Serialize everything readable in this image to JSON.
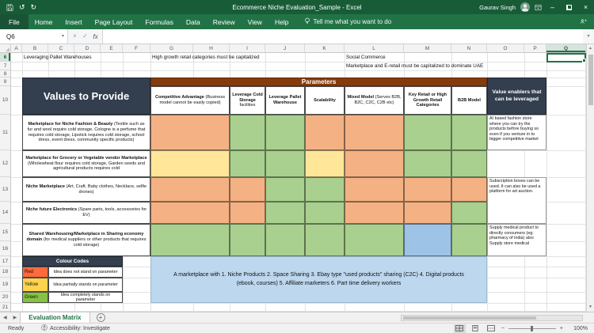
{
  "colors": {
    "title_bar": "#185C37",
    "ribbon": "#217346",
    "header_dark": "#333F4F",
    "parameters_bar": "#843C0C",
    "summary_note_bg": "#BDD7EE",
    "selection_accent": "#217346",
    "matrix_cells": {
      "orange": "#F4B183",
      "yellow": "#FFE699",
      "green": "#A9D08E",
      "blue": "#9DC3E6"
    }
  },
  "icons": {
    "undo": "↺",
    "redo": "↻",
    "dropdown": "▾",
    "cancel": "×",
    "check": "✓",
    "minimize": "–",
    "close": "×",
    "prev": "◀",
    "next": "▶",
    "up": "▲",
    "down": "▼",
    "plus": "+",
    "minus": "−"
  },
  "title_bar": {
    "title": "Ecommerce Niche Evaluation_Sample - Excel",
    "user_name": "Gaurav Singh"
  },
  "ribbon": {
    "tabs": [
      {
        "label": "File"
      },
      {
        "label": "Home"
      },
      {
        "label": "Insert"
      },
      {
        "label": "Page Layout"
      },
      {
        "label": "Formulas"
      },
      {
        "label": "Data"
      },
      {
        "label": "Review"
      },
      {
        "label": "View"
      },
      {
        "label": "Help"
      }
    ],
    "tell_me": "Tell me what you want to do"
  },
  "formula_bar": {
    "name_box": "Q6",
    "fx_label": "fx",
    "value": ""
  },
  "column_letters": [
    "A",
    "B",
    "C",
    "D",
    "E",
    "F",
    "G",
    "H",
    "I",
    "J",
    "K",
    "L",
    "M",
    "N",
    "O",
    "P",
    "Q"
  ],
  "row_numbers": [
    "6",
    "7",
    "8",
    "9",
    "10",
    "11",
    "12",
    "13",
    "14",
    "15",
    "16",
    "17",
    "18",
    "19",
    "20",
    "21"
  ],
  "notes": {
    "b6": "Leveraging Pallet Warehouses",
    "g6": "High growth retail categories must be capitalized",
    "l6": "Social Commerce",
    "l7": "Marketplace and E-retail must be capitalized to dominate UAE"
  },
  "matrix": {
    "values_header": "Values to Provide",
    "parameters_header": "Parameters",
    "enablers_header": "Value enablers that can be leveraged",
    "parameters": [
      {
        "title": "Competitive Advantage",
        "desc": "(Business model cannot be easily copied)"
      },
      {
        "title": "Leverage Cold Storage",
        "desc": "facilities"
      },
      {
        "title": "Leverage Pallet Warehouse",
        "desc": ""
      },
      {
        "title": "Scalability",
        "desc": ""
      },
      {
        "title": "Mixed Model",
        "desc": "(Serves B2B, B2C, C2C, C2B etc)"
      },
      {
        "title": "Key Retail or High Growth Retail Categories",
        "desc": ""
      },
      {
        "title": "B2B Model",
        "desc": ""
      }
    ],
    "rows": [
      {
        "title": "Marketplace for Niche Fashion & Beauty",
        "desc": "(Textile such as fur and wool require cold storage, Cologne is a perfume that requires cold storage, Lipstick requires cold storage, school dress, event dress, community specific products)",
        "cells": [
          "orange",
          "green",
          "green",
          "orange",
          "orange",
          "green",
          "green"
        ],
        "enabler": "AI based fashion store where you can try the products before buying so even if you venture in to bigger competitive market"
      },
      {
        "title": "Marketplace for Grocery or Vegetable vendor Marketplace",
        "desc": "(Wholewheat flour requires cold storage, Garden seeds and agricultural products requires cold",
        "cells": [
          "yellow",
          "green",
          "green",
          "yellow",
          "orange",
          "green",
          "green"
        ],
        "enabler": ""
      },
      {
        "title": "Niche Marketplace",
        "desc": "(Art, Craft, Baby clothes, Necklace, selfie drones)",
        "cells": [
          "orange",
          "orange",
          "green",
          "green",
          "orange",
          "orange",
          "orange"
        ],
        "enabler": "Subscription boxes can be used. It can also be used a platform for art auction."
      },
      {
        "title": "Niche future Electronics",
        "desc": "(Spare parts, tools, accessories for EV)",
        "cells": [
          "orange",
          "orange",
          "green",
          "green",
          "orange",
          "orange",
          "green"
        ],
        "enabler": ""
      },
      {
        "title": "Shared Warehousing/Marketplace in Sharing economy domain",
        "desc": "(for medical suppliers or other products that requires cold storage)",
        "cells": [
          "green",
          "green",
          "green",
          "green",
          "green",
          "blue",
          "green"
        ],
        "enabler": "Supply medical product to directly consumers (eg: pharmacy of india) also Supply store medical"
      }
    ]
  },
  "legend": {
    "header": "Colour Codes",
    "items": [
      {
        "label": "Red",
        "color": "#FF6A3C",
        "desc": "Idea does not stand on parameter"
      },
      {
        "label": "Yellow",
        "color": "#FFD34D",
        "desc": "Idea partially stands on parameter"
      },
      {
        "label": "Green",
        "color": "#84C441",
        "desc": "Idea completely stands on parameter"
      }
    ]
  },
  "summary_note": "A marketplace with 1. Niche Products 2. Space Sharing 3. Ebay type \"used products\" sharing (C2C) 4. Digital products (ebook, courses) 5. Affiliate marketers 6. Part time delivery workers",
  "sheet_tabs": {
    "active_tab": "Evaluation Matrix"
  },
  "status_bar": {
    "mode": "Ready",
    "accessibility": "Accessibility: Investigate",
    "zoom": "100%"
  }
}
